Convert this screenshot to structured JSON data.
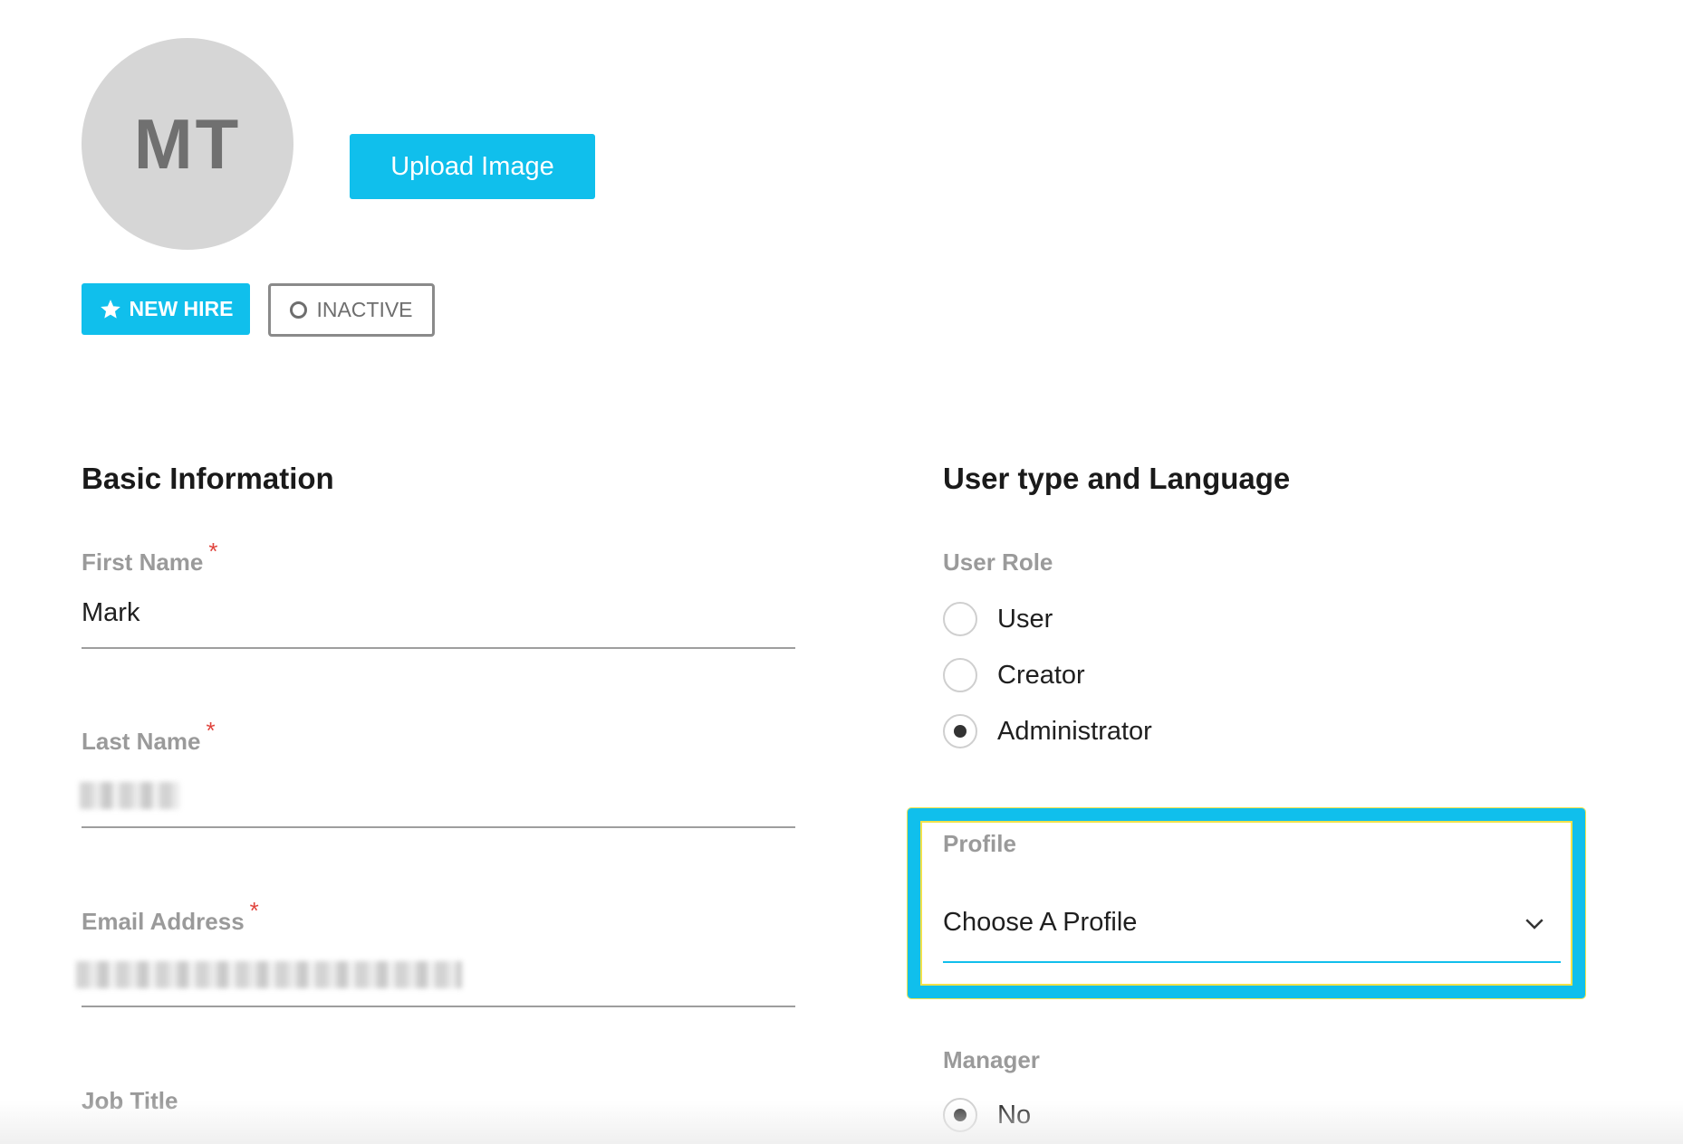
{
  "avatar": {
    "initials": "MT"
  },
  "upload_button": {
    "label": "Upload Image"
  },
  "badges": {
    "new_hire": "NEW HIRE",
    "inactive": "INACTIVE"
  },
  "basic_info": {
    "title": "Basic Information",
    "first_name": {
      "label": "First Name",
      "required": "*",
      "value": "Mark"
    },
    "last_name": {
      "label": "Last Name",
      "required": "*"
    },
    "email": {
      "label": "Email Address",
      "required": "*"
    },
    "job_title": {
      "label": "Job Title"
    }
  },
  "user_type": {
    "title": "User type and Language",
    "user_role": {
      "label": "User Role",
      "options": [
        "User",
        "Creator",
        "Administrator"
      ],
      "selected": "Administrator"
    },
    "profile": {
      "label": "Profile",
      "placeholder": "Choose A Profile"
    },
    "manager": {
      "label": "Manager",
      "options": [
        "No"
      ],
      "selected": "No"
    }
  },
  "colors": {
    "accent": "#10bfec",
    "required": "#e0443d",
    "label": "#9a9a9a"
  }
}
